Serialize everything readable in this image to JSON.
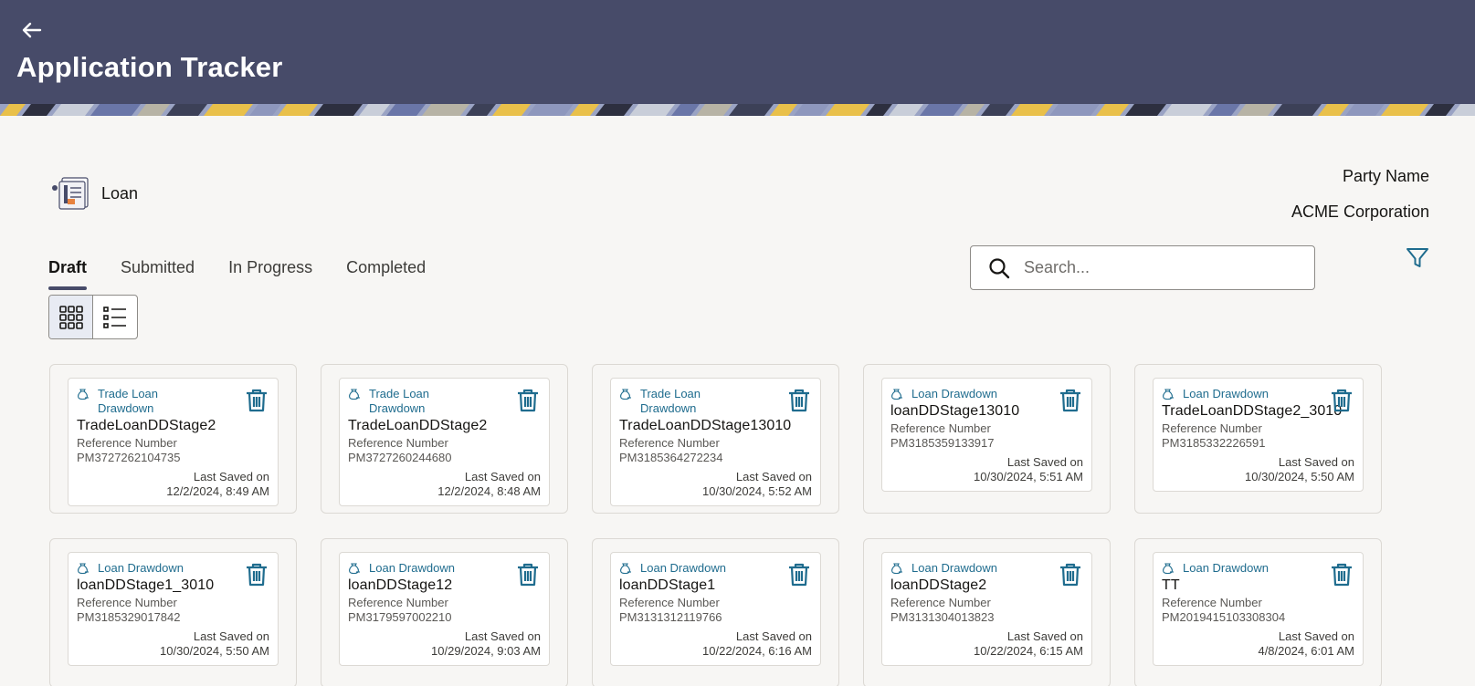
{
  "header": {
    "title": "Application Tracker",
    "back_icon": "arrow-left-icon"
  },
  "product": {
    "label": "Loan",
    "icon": "loan-document-icon"
  },
  "party": {
    "label": "Party Name",
    "value": "ACME Corporation"
  },
  "tabs": [
    {
      "label": "Draft",
      "active": true
    },
    {
      "label": "Submitted",
      "active": false
    },
    {
      "label": "In Progress",
      "active": false
    },
    {
      "label": "Completed",
      "active": false
    }
  ],
  "search": {
    "placeholder": "Search...",
    "value": ""
  },
  "view_toggle": {
    "selected": "grid",
    "options": [
      "grid-view-icon",
      "list-view-icon"
    ]
  },
  "colors": {
    "header": "#474b69",
    "accent": "#1f6c8e",
    "background": "#f7f6f4"
  },
  "cards": [
    {
      "type": "Trade Loan Drawdown",
      "name": "TradeLoanDDStage2",
      "ref_label": "Reference Number",
      "ref": "PM3727262104735",
      "saved_label": "Last Saved on",
      "saved": "12/2/2024, 8:49 AM"
    },
    {
      "type": "Trade Loan Drawdown",
      "name": "TradeLoanDDStage2",
      "ref_label": "Reference Number",
      "ref": "PM3727260244680",
      "saved_label": "Last Saved on",
      "saved": "12/2/2024, 8:48 AM"
    },
    {
      "type": "Trade Loan Drawdown",
      "name": "TradeLoanDDStage13010",
      "ref_label": "Reference Number",
      "ref": "PM3185364272234",
      "saved_label": "Last Saved on",
      "saved": "10/30/2024, 5:52 AM"
    },
    {
      "type": "Loan Drawdown",
      "name": "loanDDStage13010",
      "ref_label": "Reference Number",
      "ref": "PM3185359133917",
      "saved_label": "Last Saved on",
      "saved": "10/30/2024, 5:51 AM"
    },
    {
      "type": "Loan Drawdown",
      "name": "TradeLoanDDStage2_3010",
      "ref_label": "Reference Number",
      "ref": "PM3185332226591",
      "saved_label": "Last Saved on",
      "saved": "10/30/2024, 5:50 AM"
    },
    {
      "type": "Loan Drawdown",
      "name": "loanDDStage1_3010",
      "ref_label": "Reference Number",
      "ref": "PM3185329017842",
      "saved_label": "Last Saved on",
      "saved": "10/30/2024, 5:50 AM"
    },
    {
      "type": "Loan Drawdown",
      "name": "loanDDStage12",
      "ref_label": "Reference Number",
      "ref": "PM3179597002210",
      "saved_label": "Last Saved on",
      "saved": "10/29/2024, 9:03 AM"
    },
    {
      "type": "Loan Drawdown",
      "name": "loanDDStage1",
      "ref_label": "Reference Number",
      "ref": "PM3131312119766",
      "saved_label": "Last Saved on",
      "saved": "10/22/2024, 6:16 AM"
    },
    {
      "type": "Loan Drawdown",
      "name": "loanDDStage2",
      "ref_label": "Reference Number",
      "ref": "PM3131304013823",
      "saved_label": "Last Saved on",
      "saved": "10/22/2024, 6:15 AM"
    },
    {
      "type": "Loan Drawdown",
      "name": "TT",
      "ref_label": "Reference Number",
      "ref": "PM2019415103308304",
      "saved_label": "Last Saved on",
      "saved": "4/8/2024, 6:01 AM"
    }
  ]
}
